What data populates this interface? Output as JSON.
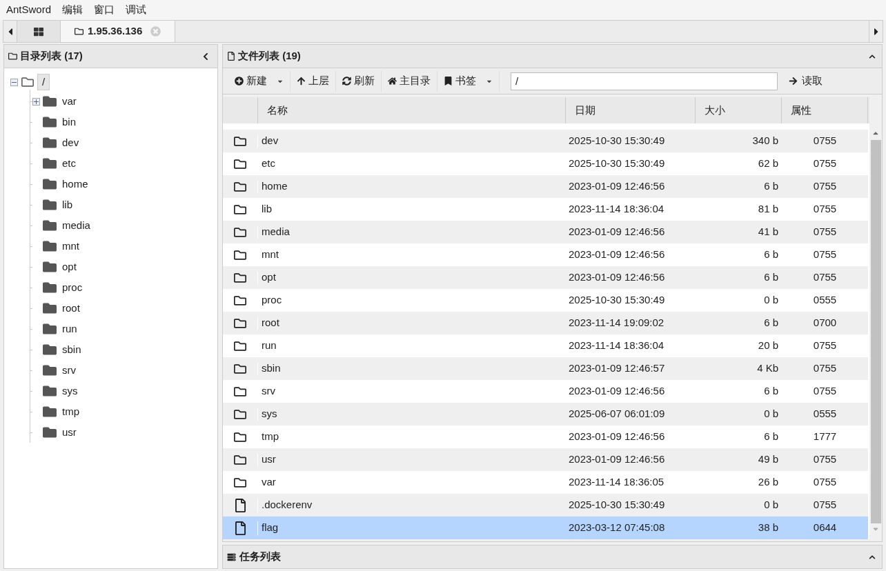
{
  "menu": [
    "AntSword",
    "编辑",
    "窗口",
    "调试"
  ],
  "tabs": [
    {
      "kind": "home",
      "selected": false
    },
    {
      "kind": "host",
      "label": "1.95.36.136",
      "selected": true
    }
  ],
  "left_panel": {
    "title": "目录列表 (17)",
    "tree": [
      {
        "label": "/",
        "expanded": true,
        "selected": true,
        "children": [
          {
            "label": "var",
            "expanded": false,
            "selected": false
          },
          {
            "label": "bin",
            "selected": false
          },
          {
            "label": "dev",
            "selected": false
          },
          {
            "label": "etc",
            "selected": false
          },
          {
            "label": "home",
            "selected": false
          },
          {
            "label": "lib",
            "selected": false
          },
          {
            "label": "media",
            "selected": false
          },
          {
            "label": "mnt",
            "selected": false
          },
          {
            "label": "opt",
            "selected": false
          },
          {
            "label": "proc",
            "selected": false
          },
          {
            "label": "root",
            "selected": false
          },
          {
            "label": "run",
            "selected": false
          },
          {
            "label": "sbin",
            "selected": false
          },
          {
            "label": "srv",
            "selected": false
          },
          {
            "label": "sys",
            "selected": false
          },
          {
            "label": "tmp",
            "selected": false
          },
          {
            "label": "usr",
            "selected": false
          }
        ]
      }
    ]
  },
  "right_panel": {
    "title": "文件列表 (19)",
    "toolbar": [
      {
        "kind": "new",
        "label": "新建",
        "dropdown": true
      },
      {
        "kind": "up",
        "label": "上层",
        "dropdown": false
      },
      {
        "kind": "refresh",
        "label": "刷新",
        "dropdown": false
      },
      {
        "kind": "home",
        "label": "主目录",
        "dropdown": false
      },
      {
        "kind": "bookmark",
        "label": "书签",
        "dropdown": true
      }
    ],
    "path": "/",
    "read_button": "读取",
    "columns": [
      "名称",
      "日期",
      "大小",
      "属性"
    ],
    "rows": [
      {
        "kind": "folder",
        "name": "dev",
        "date": "2025-10-30 15:30:49",
        "size": "340 b",
        "perm": "0755",
        "selected": false
      },
      {
        "kind": "folder",
        "name": "etc",
        "date": "2025-10-30 15:30:49",
        "size": "62 b",
        "perm": "0755",
        "selected": false
      },
      {
        "kind": "folder",
        "name": "home",
        "date": "2023-01-09 12:46:56",
        "size": "6 b",
        "perm": "0755",
        "selected": false
      },
      {
        "kind": "folder",
        "name": "lib",
        "date": "2023-11-14 18:36:04",
        "size": "81 b",
        "perm": "0755",
        "selected": false
      },
      {
        "kind": "folder",
        "name": "media",
        "date": "2023-01-09 12:46:56",
        "size": "41 b",
        "perm": "0755",
        "selected": false
      },
      {
        "kind": "folder",
        "name": "mnt",
        "date": "2023-01-09 12:46:56",
        "size": "6 b",
        "perm": "0755",
        "selected": false
      },
      {
        "kind": "folder",
        "name": "opt",
        "date": "2023-01-09 12:46:56",
        "size": "6 b",
        "perm": "0755",
        "selected": false
      },
      {
        "kind": "folder",
        "name": "proc",
        "date": "2025-10-30 15:30:49",
        "size": "0 b",
        "perm": "0555",
        "selected": false
      },
      {
        "kind": "folder",
        "name": "root",
        "date": "2023-11-14 19:09:02",
        "size": "6 b",
        "perm": "0700",
        "selected": false
      },
      {
        "kind": "folder",
        "name": "run",
        "date": "2023-11-14 18:36:04",
        "size": "20 b",
        "perm": "0755",
        "selected": false
      },
      {
        "kind": "folder",
        "name": "sbin",
        "date": "2023-01-09 12:46:57",
        "size": "4 Kb",
        "perm": "0755",
        "selected": false
      },
      {
        "kind": "folder",
        "name": "srv",
        "date": "2023-01-09 12:46:56",
        "size": "6 b",
        "perm": "0755",
        "selected": false
      },
      {
        "kind": "folder",
        "name": "sys",
        "date": "2025-06-07 06:01:09",
        "size": "0 b",
        "perm": "0555",
        "selected": false
      },
      {
        "kind": "folder",
        "name": "tmp",
        "date": "2023-01-09 12:46:56",
        "size": "6 b",
        "perm": "1777",
        "selected": false
      },
      {
        "kind": "folder",
        "name": "usr",
        "date": "2023-01-09 12:46:56",
        "size": "49 b",
        "perm": "0755",
        "selected": false
      },
      {
        "kind": "folder",
        "name": "var",
        "date": "2023-11-14 18:36:05",
        "size": "26 b",
        "perm": "0755",
        "selected": false
      },
      {
        "kind": "file",
        "name": ".dockerenv",
        "date": "2025-10-30 15:30:49",
        "size": "0 b",
        "perm": "0755",
        "selected": false
      },
      {
        "kind": "file",
        "name": "flag",
        "date": "2023-03-12 07:45:08",
        "size": "38 b",
        "perm": "0644",
        "selected": true
      }
    ]
  },
  "task_panel": {
    "title": "任务列表"
  }
}
